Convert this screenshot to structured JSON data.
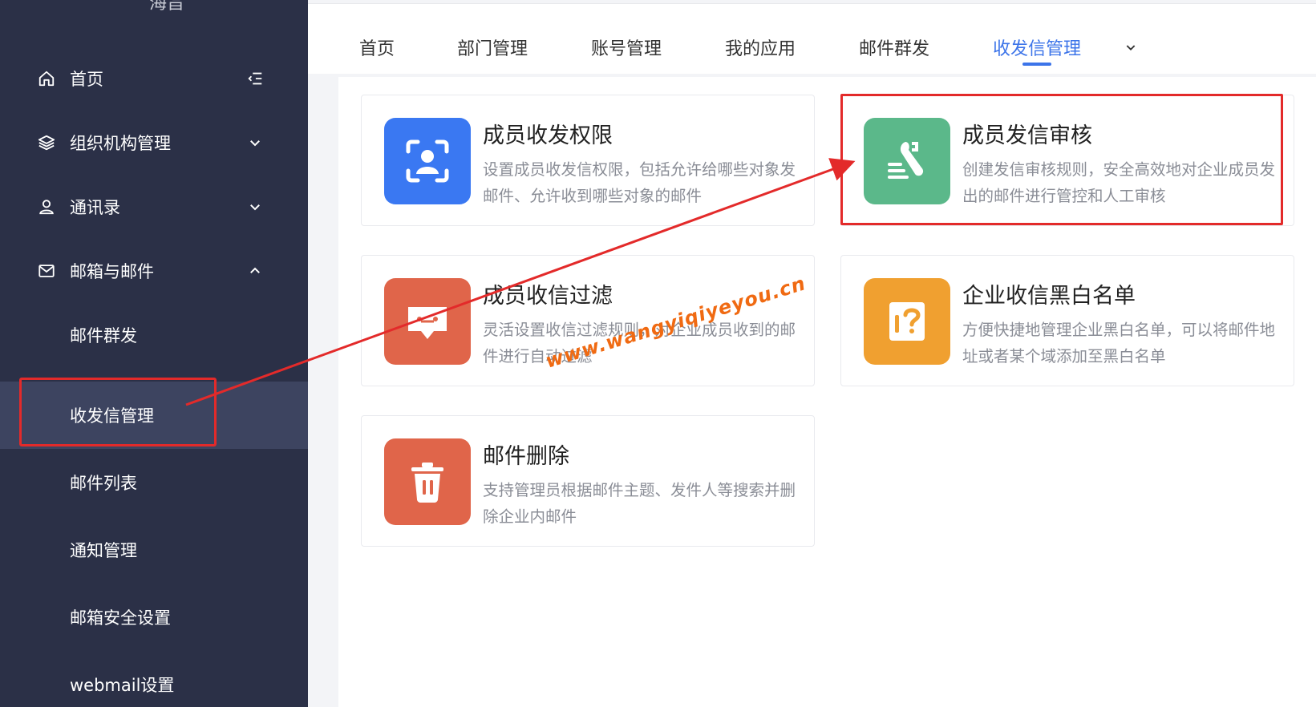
{
  "brand": {
    "fragment": "海旨"
  },
  "sidebar": {
    "items": [
      {
        "label": "首页",
        "icon": "home-icon",
        "right_icon": "menu-fold-icon"
      },
      {
        "label": "组织机构管理",
        "icon": "layers-icon",
        "right_icon": "chevron-down-icon"
      },
      {
        "label": "通讯录",
        "icon": "user-icon",
        "right_icon": "chevron-down-icon"
      },
      {
        "label": "邮箱与邮件",
        "icon": "mail-icon",
        "right_icon": "chevron-up-icon"
      }
    ],
    "sub_items": [
      {
        "label": "邮件群发"
      },
      {
        "label": "收发信管理",
        "active": true
      },
      {
        "label": "邮件列表"
      },
      {
        "label": "通知管理"
      },
      {
        "label": "邮箱安全设置"
      },
      {
        "label": "webmail设置"
      }
    ]
  },
  "tabs": {
    "items": [
      {
        "label": "首页"
      },
      {
        "label": "部门管理"
      },
      {
        "label": "账号管理"
      },
      {
        "label": "我的应用"
      },
      {
        "label": "邮件群发"
      },
      {
        "label": "收发信管理",
        "active": true
      }
    ],
    "more_icon": "chevron-down-icon"
  },
  "cards": [
    {
      "title": "成员收发权限",
      "desc": "设置成员收发信权限，包括允许给哪些对象发邮件、允许收到哪些对象的邮件",
      "icon": "user-scan-icon",
      "color": "#3a78f2"
    },
    {
      "title": "成员发信审核",
      "desc": "创建发信审核规则，安全高效地对企业成员发出的邮件进行管控和人工审核",
      "icon": "wrench-icon",
      "color": "#5bb88a"
    },
    {
      "title": "成员收信过滤",
      "desc": "灵活设置收信过滤规则，对企业成员收到的邮件进行自动过滤",
      "icon": "message-filter-icon",
      "color": "#e0654a"
    },
    {
      "title": "企业收信黑白名单",
      "desc": "方便快捷地管理企业黑白名单，可以将邮件地址或者某个域添加至黑白名单",
      "icon": "question-list-icon",
      "color": "#f0a030"
    },
    {
      "title": "邮件删除",
      "desc": "支持管理员根据邮件主题、发件人等搜索并删除企业内邮件",
      "icon": "trash-icon",
      "color": "#e0654a"
    }
  ],
  "annotations": {
    "watermark": "www.wangyiqiyeyou.cn",
    "highlight_color": "#e32a2a"
  }
}
